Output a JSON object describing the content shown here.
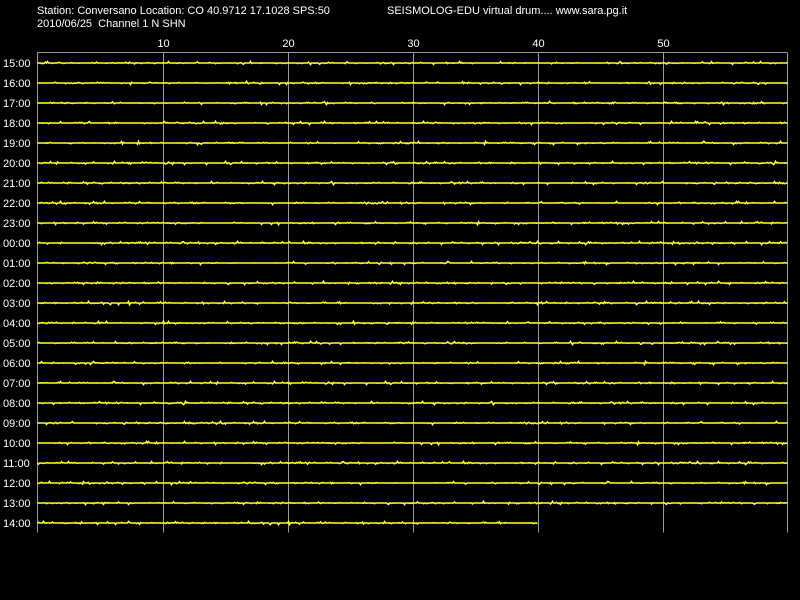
{
  "header": {
    "station_info": "Station: Conversano Location: CO 40.9712 17.1028 SPS:50",
    "app_title": "SEISMOLOG-EDU virtual drum.... www.sara.pg.it",
    "date_channel": "2010/06/25  Channel 1 N SHN"
  },
  "colors": {
    "background": "#000000",
    "trace": "#ffff33",
    "grid": "#9a9a9a",
    "text": "#ffffff"
  },
  "chart_data": {
    "type": "line",
    "title": "",
    "xlabel": "",
    "ylabel": "",
    "x_axis": {
      "min": 0,
      "max": 60,
      "ticks": [
        10,
        20,
        30,
        40,
        50
      ],
      "unit": "minutes"
    },
    "grid": true,
    "rows": [
      {
        "label": "15:00",
        "end_minute": 60
      },
      {
        "label": "16:00",
        "end_minute": 60
      },
      {
        "label": "17:00",
        "end_minute": 60
      },
      {
        "label": "18:00",
        "end_minute": 60
      },
      {
        "label": "19:00",
        "end_minute": 60
      },
      {
        "label": "20:00",
        "end_minute": 60
      },
      {
        "label": "21:00",
        "end_minute": 60
      },
      {
        "label": "22:00",
        "end_minute": 60
      },
      {
        "label": "23:00",
        "end_minute": 60
      },
      {
        "label": "00:00",
        "end_minute": 60
      },
      {
        "label": "01:00",
        "end_minute": 60
      },
      {
        "label": "02:00",
        "end_minute": 60
      },
      {
        "label": "03:00",
        "end_minute": 60
      },
      {
        "label": "04:00",
        "end_minute": 60
      },
      {
        "label": "05:00",
        "end_minute": 60
      },
      {
        "label": "06:00",
        "end_minute": 60
      },
      {
        "label": "07:00",
        "end_minute": 60
      },
      {
        "label": "08:00",
        "end_minute": 60
      },
      {
        "label": "09:00",
        "end_minute": 60
      },
      {
        "label": "10:00",
        "end_minute": 60
      },
      {
        "label": "11:00",
        "end_minute": 60
      },
      {
        "label": "12:00",
        "end_minute": 60
      },
      {
        "label": "13:00",
        "end_minute": 60
      },
      {
        "label": "14:00",
        "end_minute": 40
      }
    ]
  }
}
